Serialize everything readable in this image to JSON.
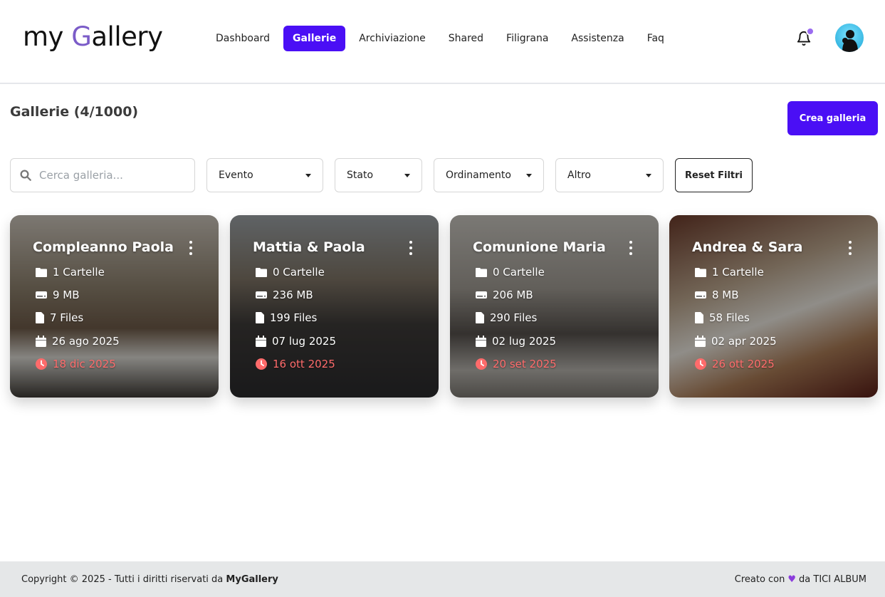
{
  "header": {
    "logo": {
      "prefix": "my ",
      "g": "G",
      "suffix": "allery"
    },
    "nav": [
      {
        "label": "Dashboard",
        "active": false
      },
      {
        "label": "Gallerie",
        "active": true
      },
      {
        "label": "Archiviazione",
        "active": false
      },
      {
        "label": "Shared",
        "active": false
      },
      {
        "label": "Filigrana",
        "active": false
      },
      {
        "label": "Assistenza",
        "active": false
      },
      {
        "label": "Faq",
        "active": false
      }
    ],
    "icons": {
      "notifications": "bell-icon",
      "avatar": "user-avatar"
    },
    "colors": {
      "accent": "#4a0ff5",
      "badge": "#9b6cf0"
    }
  },
  "page": {
    "title": "Gallerie (4/1000)",
    "create_label": "Crea galleria"
  },
  "filters": {
    "search_placeholder": "Cerca galleria...",
    "evento": "Evento",
    "stato": "Stato",
    "ordinamento": "Ordinamento",
    "altro": "Altro",
    "reset_label": "Reset Filtri"
  },
  "galleries": [
    {
      "title": "Compleanno Paola",
      "folders": "1 Cartelle",
      "size": "9 MB",
      "files": "7 Files",
      "date": "26 ago 2025",
      "expiry": "18 dic 2025"
    },
    {
      "title": "Mattia & Paola",
      "folders": "0 Cartelle",
      "size": "236 MB",
      "files": "199 Files",
      "date": "07 lug 2025",
      "expiry": "16 ott 2025"
    },
    {
      "title": "Comunione Maria",
      "folders": "0 Cartelle",
      "size": "206 MB",
      "files": "290 Files",
      "date": "02 lug 2025",
      "expiry": "20 set 2025"
    },
    {
      "title": "Andrea & Sara",
      "folders": "1 Cartelle",
      "size": "8 MB",
      "files": "58 Files",
      "date": "02 apr 2025",
      "expiry": "26 ott 2025"
    }
  ],
  "footer": {
    "copyright": "Copyright © 2025 - Tutti i diritti riservati da",
    "brand": "MyGallery",
    "created_prefix": "Creato con",
    "heart": "♥",
    "created_suffix": "da TICI ALBUM"
  }
}
